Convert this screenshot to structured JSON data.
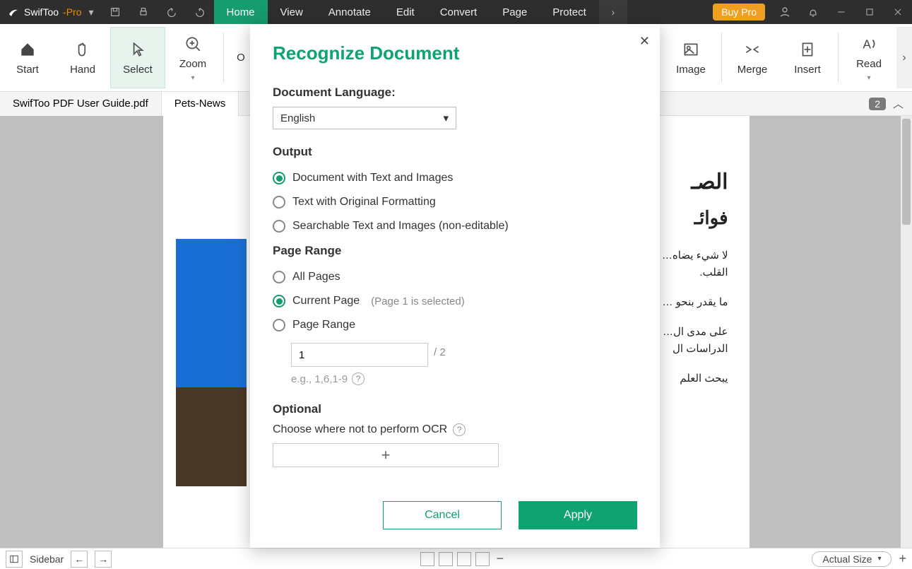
{
  "titlebar": {
    "app_prefix": "SwifToo",
    "app_suffix": "-Pro",
    "buy_pro": "Buy Pro"
  },
  "menu": [
    "Home",
    "View",
    "Annotate",
    "Edit",
    "Convert",
    "Page",
    "Protect"
  ],
  "menu_active_index": 0,
  "ribbon": [
    {
      "label": "Start",
      "name": "start"
    },
    {
      "label": "Hand",
      "name": "hand"
    },
    {
      "label": "Select",
      "name": "select"
    },
    {
      "label": "Zoom",
      "name": "zoom"
    },
    {
      "label": "O",
      "name": "ocr-cut"
    },
    {
      "label": "Image",
      "name": "image"
    },
    {
      "label": "Merge",
      "name": "merge"
    },
    {
      "label": "Insert",
      "name": "insert"
    },
    {
      "label": "Read",
      "name": "read"
    }
  ],
  "doctabs": {
    "tab1": "SwifToo PDF User Guide.pdf",
    "tab2": "Pets-News",
    "badge": "2"
  },
  "dialog": {
    "title": "Recognize Document",
    "lang_label": "Document Language:",
    "lang_value": "English",
    "output_label": "Output",
    "output_options": [
      "Document with Text and Images",
      "Text with Original Formatting",
      "Searchable Text and Images (non-editable)"
    ],
    "output_selected": 0,
    "range_label": "Page Range",
    "range_options": {
      "all": "All Pages",
      "current": "Current Page",
      "current_note": "(Page 1 is selected)",
      "range": "Page Range"
    },
    "range_selected": "current",
    "range_value": "1",
    "range_total": "/ 2",
    "range_hint": "e.g., 1,6,1-9",
    "optional_label": "Optional",
    "optional_text": "Choose where not to perform OCR",
    "cancel": "Cancel",
    "apply": "Apply"
  },
  "arabic": {
    "h1": "الصـ",
    "h2": "فوائـ",
    "p1": "لا شيء يضاه… غيرالمشروط… صحـ بـ تك. … صحة القلب.",
    "p2": "ما يقدر بنحو … المستفيد من",
    "p3": "على مدى ال… للصحة شرا… لشركة مارس… الدراسات ال",
    "p4": "يبحث العلم"
  },
  "statusbar": {
    "sidebar": "Sidebar",
    "zoom_mode": "Actual Size"
  }
}
